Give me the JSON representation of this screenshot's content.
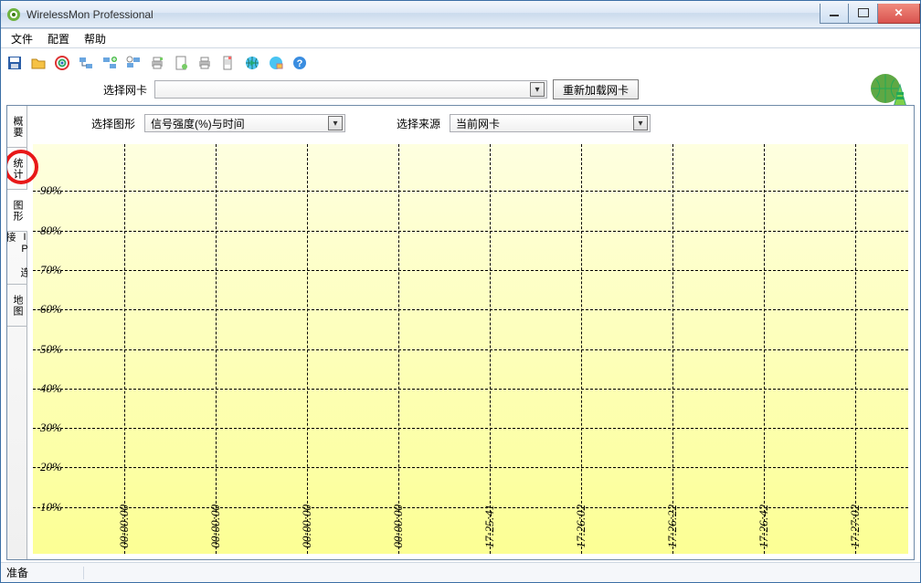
{
  "window": {
    "title": "WirelessMon Professional"
  },
  "menu": {
    "file": "文件",
    "config": "配置",
    "help": "帮助"
  },
  "toolbar_icons": [
    "save",
    "folder",
    "target",
    "net-list",
    "net-add",
    "net-mon",
    "printer",
    "page",
    "printer2",
    "doc",
    "globe-play",
    "globe-mon",
    "help"
  ],
  "adapter": {
    "label": "选择网卡",
    "selected": "",
    "reload_btn": "重新加载网卡"
  },
  "side_tabs": {
    "summary": "概要",
    "stats": "统计",
    "graph": "图形",
    "ip": "IP 连接",
    "map": "地图"
  },
  "graph_selectors": {
    "graph_label": "选择图形",
    "graph_value": "信号强度(%)与时间",
    "source_label": "选择来源",
    "source_value": "当前网卡"
  },
  "chart_data": {
    "type": "line",
    "title": "",
    "xlabel": "",
    "ylabel": "",
    "ylim": [
      0,
      100
    ],
    "y_ticks": [
      10,
      20,
      30,
      40,
      50,
      60,
      70,
      80,
      90
    ],
    "y_tick_labels": [
      "10%",
      "20%",
      "30%",
      "40%",
      "50%",
      "60%",
      "70%",
      "80%",
      "90%"
    ],
    "x_tick_labels": [
      "00:00:00",
      "00:00:00",
      "00:00:00",
      "00:00:00",
      "17:25:41",
      "17:26:02",
      "17:26:22",
      "17:26:42",
      "17:27:02"
    ],
    "series": [
      {
        "name": "信号强度(%)",
        "values": []
      }
    ]
  },
  "statusbar": {
    "text": "准备"
  }
}
